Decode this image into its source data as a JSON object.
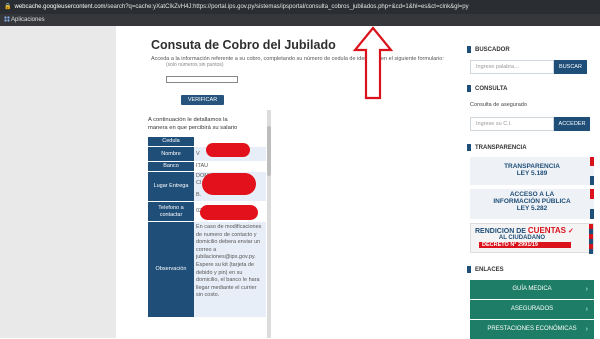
{
  "browser": {
    "url_host": "webcache.googleusercontent.com",
    "url_rest": "/search?q=cache:yXatCIkZvH4J:https://portal.ips.gov.py/sistemas/ipsportal/consulta_cobros_jubilados.php+&cd=1&hl=es&ct=clnk&gl=py",
    "bookmarks_label": "Aplicaciones"
  },
  "main": {
    "title": "Consuta de Cobro del Jubilado",
    "intro": "Acceda a la información referente a su cobro, completando su número de cedula de identidad en el siguiente formulario:",
    "intro_hint": "(solo números sin puntos)",
    "verify_label": "VERIFICAR",
    "result_line1": "A continuación le detallamos la",
    "result_line2": "manera en que percibirá su salario",
    "table": {
      "cedula_label": "Cedula",
      "nombre_label": "Nombre",
      "nombre_value": "V",
      "banco_label": "Banco",
      "banco_value": "ITAU",
      "lugar_label": "Lugar Entrega",
      "lugar_value1": "DOM",
      "lugar_value2": "CI",
      "lugar_value3": "B.",
      "telefono_label": "Telefono a contactar",
      "telefono_value": "02",
      "telefono_tail": "6",
      "observacion_label": "Observación",
      "observacion_value": "En caso de modificaciones de numero de contacto y domicilio debera enviar un correo a jubilaciones@ips.gov.py. Espere su kit (tarjeta de debido y pin) en su domicilio, el banco le hara llegar mediante el currier sin costo."
    }
  },
  "sidebar": {
    "buscador_title": "BUSCADOR",
    "search_placeholder": "Ingrese palabra...",
    "search_button": "BUSCAR",
    "consulta_title": "CONSULTA",
    "consulta_label": "Consulta de asegurado",
    "ci_placeholder": "Ingrese su C.I.",
    "ci_button": "ACCEDER",
    "transparencia_title": "TRANSPARENCIA",
    "banner1_line1": "TRANSPARENCIA",
    "banner1_line2": "LEY 5.189",
    "banner2_line1": "ACCESO A LA",
    "banner2_line2": "INFORMACIÓN PÚBLICA",
    "banner2_line3": "LEY 5.282",
    "banner3_line1a": "RENDICION DE",
    "banner3_line1b": "CUENTAS",
    "banner3_line2": "AL CIUDADANO",
    "banner3_line3": "DECRETO N° 2991/19",
    "enlaces_title": "ENLACES",
    "links": [
      "GUÍA MEDICA",
      "ASEGURADOS",
      "PRESTACIONES ECONÓMICAS"
    ]
  },
  "colors": {
    "accent": "#1f4e79",
    "link_green": "#1e7d67",
    "redaction": "#e3111b"
  }
}
